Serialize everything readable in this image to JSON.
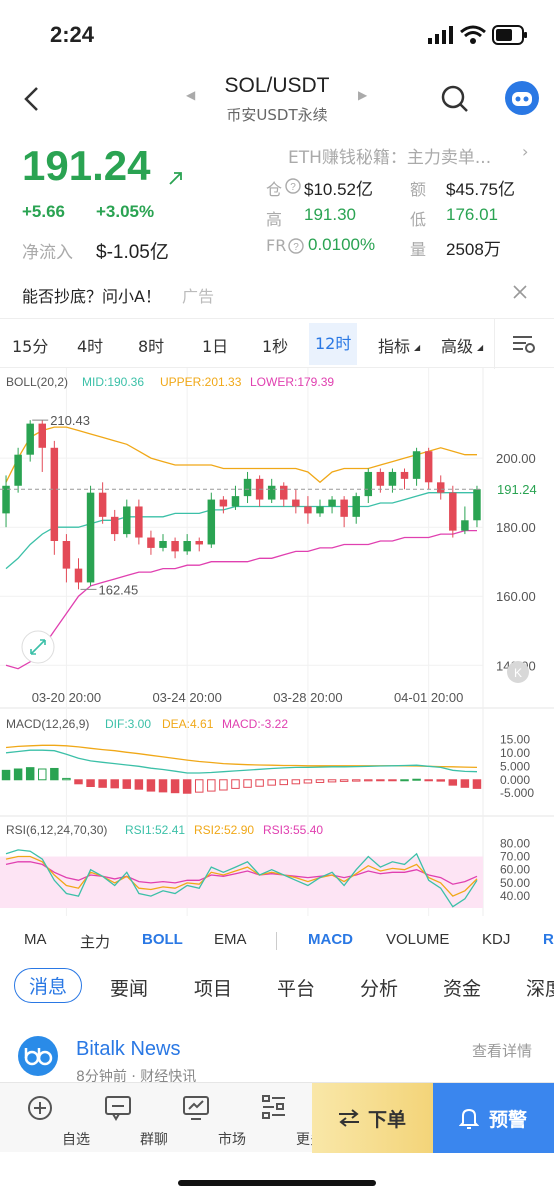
{
  "status": {
    "time": "2:24"
  },
  "header": {
    "pair": "SOL/USDT",
    "exchange": "币安USDT永续"
  },
  "ticker": {
    "price": "191.24",
    "change": "+5.66",
    "change_pct": "+3.05%",
    "inflow_label": "净流入",
    "inflow_value": "$-1.05亿",
    "promo_text": "ETH赚钱秘籍：主力卖单...",
    "oi_label": "仓",
    "oi_value": "$10.52亿",
    "amount_label": "额",
    "amount_value": "$45.75亿",
    "high_label": "高",
    "high_value": "191.30",
    "low_label": "低",
    "low_value": "176.01",
    "fr_label": "FR",
    "fr_value": "0.0100%",
    "vol_label": "量",
    "vol_value": "2508万"
  },
  "ad": {
    "text": "能否抄底？问小A！",
    "tag": "广告"
  },
  "timeframes": [
    "15分",
    "4时",
    "8时",
    "1日",
    "1秒",
    "12时",
    "指标",
    "高级"
  ],
  "active_timeframe": "12时",
  "boll": {
    "label": "BOLL(20,2)",
    "mid": "MID:190.36",
    "upper": "UPPER:201.33",
    "lower": "LOWER:179.39",
    "high_mark": "210.43",
    "low_mark": "162.45",
    "current_price_tag": "191.24",
    "k_badge": "K"
  },
  "macd": {
    "label": "MACD(12,26,9)",
    "dif": "DIF:3.00",
    "dea": "DEA:4.61",
    "macd": "MACD:-3.22"
  },
  "rsi": {
    "label": "RSI(6,12,24,70,30)",
    "rsi1": "RSI1:52.41",
    "rsi2": "RSI2:52.90",
    "rsi3": "RSI3:55.40"
  },
  "indicator_tabs": [
    "MA",
    "主力",
    "BOLL",
    "EMA",
    "MACD",
    "VOLUME",
    "KDJ",
    "R"
  ],
  "news_tabs": [
    "消息",
    "要闻",
    "项目",
    "平台",
    "分析",
    "资金",
    "深度"
  ],
  "news": {
    "source": "Bitalk News",
    "time": "8分钟前 · 财经快讯",
    "more": "查看详情"
  },
  "bottom_nav": {
    "items": [
      "自选",
      "群聊",
      "市场",
      "更多"
    ],
    "order": "下单",
    "alert": "预警"
  },
  "colors": {
    "up": "#2aa352",
    "down": "#e34a57",
    "accent": "#2a78e4",
    "boll_mid": "#3cc0a8",
    "boll_upper": "#f0a818",
    "boll_lower": "#e040b0"
  },
  "chart_data": [
    {
      "type": "candlestick",
      "title": "BOLL(20,2)",
      "x_tick_labels": [
        "03-20 20:00",
        "03-24 20:00",
        "03-28 20:00",
        "04-01 20:00"
      ],
      "y_ticks": [
        140.0,
        160.0,
        180.0,
        200.0
      ],
      "ylim": [
        134,
        218
      ],
      "candles": [
        [
          184,
          192,
          180,
          195
        ],
        [
          192,
          201,
          190,
          203
        ],
        [
          201,
          210,
          199,
          211
        ],
        [
          210,
          203,
          196,
          211
        ],
        [
          203,
          176,
          172,
          205
        ],
        [
          176,
          168,
          164,
          178
        ],
        [
          168,
          164,
          162,
          171
        ],
        [
          164,
          190,
          163,
          192
        ],
        [
          190,
          183,
          181,
          193
        ],
        [
          183,
          178,
          176,
          185
        ],
        [
          178,
          186,
          177,
          188
        ],
        [
          186,
          177,
          175,
          188
        ],
        [
          177,
          174,
          172,
          179
        ],
        [
          174,
          176,
          173,
          178
        ],
        [
          176,
          173,
          171,
          177
        ],
        [
          173,
          176,
          172,
          178
        ],
        [
          176,
          175,
          173,
          177
        ],
        [
          175,
          188,
          174,
          190
        ],
        [
          188,
          186,
          184,
          189
        ],
        [
          186,
          189,
          185,
          192
        ],
        [
          189,
          194,
          187,
          196
        ],
        [
          194,
          188,
          186,
          195
        ],
        [
          188,
          192,
          187,
          194
        ],
        [
          192,
          188,
          186,
          193
        ],
        [
          188,
          186,
          184,
          191
        ],
        [
          186,
          184,
          181,
          189
        ],
        [
          184,
          186,
          183,
          188
        ],
        [
          186,
          188,
          184,
          189
        ],
        [
          188,
          183,
          180,
          189
        ],
        [
          183,
          189,
          181,
          190
        ],
        [
          189,
          196,
          187,
          197
        ],
        [
          196,
          192,
          190,
          197
        ],
        [
          192,
          196,
          190,
          197
        ],
        [
          196,
          194,
          191,
          197
        ],
        [
          194,
          202,
          192,
          203
        ],
        [
          202,
          193,
          191,
          203
        ],
        [
          193,
          190,
          188,
          195
        ],
        [
          190,
          179,
          177,
          192
        ],
        [
          179,
          182,
          178,
          186
        ],
        [
          182,
          191,
          180,
          192
        ]
      ],
      "boll_mid": [
        168,
        171,
        175,
        178,
        180,
        180,
        180,
        181,
        182,
        182,
        183,
        183,
        183,
        183,
        184,
        184,
        184,
        185,
        185,
        186,
        186,
        186,
        186,
        186,
        186,
        186,
        186,
        186,
        186,
        186,
        186,
        187,
        187,
        188,
        189,
        190,
        190,
        190,
        190,
        190
      ],
      "boll_upper": [
        193,
        200,
        206,
        208,
        209,
        209,
        208,
        207,
        206,
        205,
        204,
        202,
        200,
        199,
        198,
        198,
        198,
        198,
        197,
        197,
        197,
        197,
        197,
        197,
        197,
        196,
        193,
        196,
        197,
        197,
        197,
        198,
        199,
        200,
        201,
        202,
        203,
        202,
        201,
        201
      ],
      "boll_lower": [
        140,
        139,
        141,
        145,
        150,
        155,
        160,
        163,
        164,
        165,
        166,
        167,
        167,
        168,
        168,
        169,
        169,
        170,
        170,
        170,
        170,
        171,
        171,
        172,
        173,
        173,
        174,
        174,
        175,
        175,
        175,
        176,
        176,
        177,
        177,
        177,
        178,
        178,
        179,
        179
      ]
    },
    {
      "type": "bar",
      "title": "MACD(12,26,9)",
      "y_ticks": [
        -5.0,
        0.0,
        5.0,
        10.0,
        15.0
      ],
      "ylim": [
        -9,
        17
      ],
      "histogram": [
        3.5,
        4.0,
        4.5,
        4.0,
        4.2,
        0.5,
        -1.5,
        -2.5,
        -2.8,
        -3.0,
        -3.2,
        -3.5,
        -4.2,
        -4.5,
        -4.8,
        -5.0,
        -4.6,
        -4.2,
        -3.8,
        -3.2,
        -2.8,
        -2.4,
        -2.0,
        -1.8,
        -1.5,
        -1.2,
        -1.0,
        -0.8,
        -0.6,
        -0.5,
        -0.4,
        -0.2,
        -0.1,
        0.0,
        0.2,
        -0.2,
        -0.5,
        -2.0,
        -2.8,
        -3.2
      ],
      "dif": [
        10,
        10.5,
        11,
        11,
        10.8,
        9.5,
        8,
        7,
        6.5,
        6,
        5.5,
        5,
        4.3,
        3.8,
        3.2,
        2.5,
        2.5,
        2.7,
        3,
        3.3,
        3.6,
        3.9,
        4.2,
        4.4,
        4.6,
        4.6,
        4.7,
        4.8,
        4.8,
        4.9,
        5,
        5.1,
        5.2,
        5.3,
        5.4,
        5.0,
        4.6,
        3.5,
        3.1,
        3.0
      ],
      "dea": [
        12,
        12.4,
        12.6,
        12.8,
        12.8,
        12.6,
        12.2,
        11.7,
        11.2,
        10.8,
        10.2,
        9.7,
        9.1,
        8.5,
        7.9,
        7.3,
        6.8,
        6.4,
        6.0,
        5.8,
        5.6,
        5.5,
        5.4,
        5.3,
        5.3,
        5.2,
        5.2,
        5.2,
        5.2,
        5.2,
        5.2,
        5.2,
        5.2,
        5.2,
        5.1,
        5.0,
        4.9,
        4.8,
        4.7,
        4.61
      ]
    },
    {
      "type": "line",
      "title": "RSI(6,12,24,70,30)",
      "y_ticks": [
        40.0,
        50.0,
        60.0,
        70.0,
        80.0
      ],
      "ylim": [
        31,
        84
      ],
      "rsi1": [
        72,
        75,
        74,
        68,
        52,
        42,
        40,
        60,
        55,
        48,
        58,
        42,
        40,
        44,
        42,
        48,
        46,
        62,
        58,
        62,
        66,
        56,
        60,
        56,
        52,
        48,
        54,
        58,
        48,
        60,
        70,
        62,
        66,
        64,
        72,
        52,
        46,
        32,
        38,
        52
      ],
      "rsi2": [
        68,
        70,
        70,
        66,
        56,
        48,
        46,
        58,
        55,
        50,
        55,
        46,
        45,
        47,
        46,
        50,
        49,
        58,
        56,
        59,
        62,
        56,
        58,
        56,
        54,
        51,
        54,
        56,
        51,
        57,
        63,
        59,
        61,
        60,
        64,
        54,
        50,
        40,
        44,
        53
      ],
      "rsi3": [
        64,
        66,
        66,
        64,
        58,
        54,
        52,
        56,
        55,
        53,
        55,
        51,
        50,
        51,
        50,
        52,
        52,
        56,
        55,
        57,
        59,
        56,
        57,
        56,
        55,
        54,
        55,
        56,
        54,
        56,
        59,
        57,
        58,
        58,
        60,
        56,
        54,
        49,
        51,
        55
      ]
    }
  ]
}
